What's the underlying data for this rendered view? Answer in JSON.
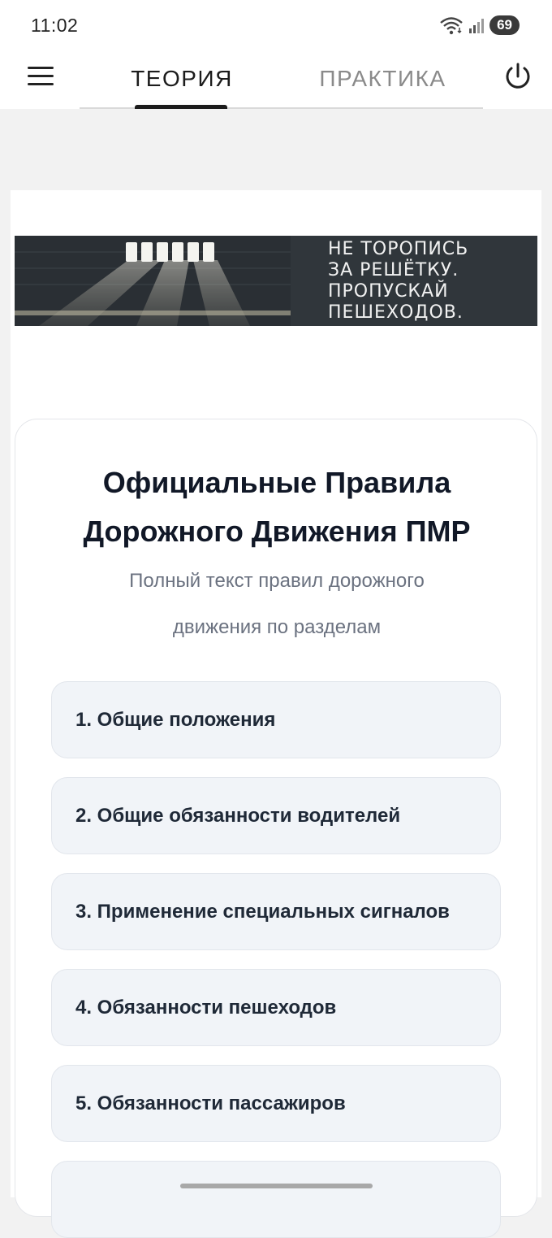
{
  "status_bar": {
    "time": "11:02",
    "battery": "69"
  },
  "tabs": {
    "theory": "ТЕОРИЯ",
    "practice": "ПРАКТИКА"
  },
  "banner": {
    "lines": [
      "НЕ ТОРОПИСЬ",
      "ЗА РЕШЁТКУ.",
      "ПРОПУСКАЙ",
      "ПЕШЕХОДОВ."
    ]
  },
  "card": {
    "title_lines": [
      "Официальные Правила",
      "Дорожного Движения ПМР"
    ],
    "subtitle_lines": [
      "Полный текст правил дорожного",
      "движения по разделам"
    ]
  },
  "sections": [
    "1. Общие положения",
    "2. Общие обязанности водителей",
    "3. Применение специальных сигналов",
    "4. Обязанности пешеходов",
    "5. Обязанности пассажиров",
    ""
  ],
  "icons": {
    "menu": "hamburger-menu-icon",
    "power": "power-icon",
    "wifi": "wifi-icon",
    "signal": "cellular-signal-icon"
  }
}
